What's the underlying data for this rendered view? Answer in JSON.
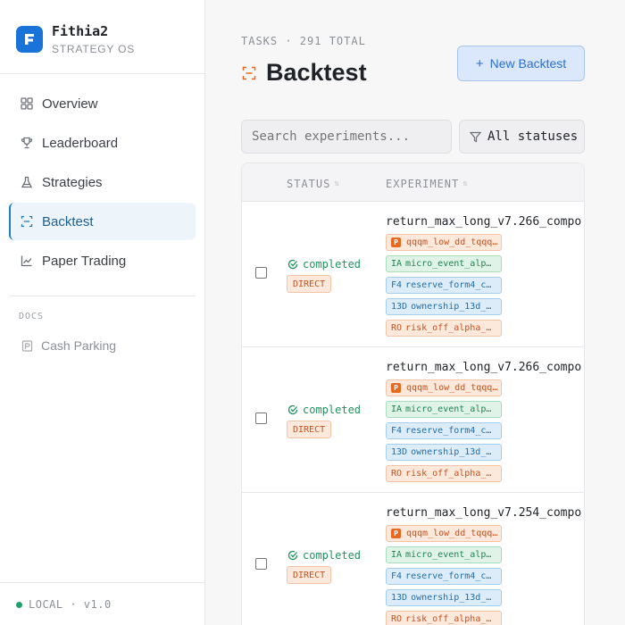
{
  "brand": {
    "name": "Fithia2",
    "subtitle": "STRATEGY OS",
    "logo_letter": "F"
  },
  "nav": [
    {
      "label": "Overview",
      "icon": "grid-icon"
    },
    {
      "label": "Leaderboard",
      "icon": "trophy-icon"
    },
    {
      "label": "Strategies",
      "icon": "flask-icon"
    },
    {
      "label": "Backtest",
      "icon": "scan-icon",
      "active": true
    },
    {
      "label": "Paper Trading",
      "icon": "chart-line-icon"
    }
  ],
  "docs": {
    "label": "DOCS",
    "items": [
      {
        "label": "Cash Parking",
        "icon": "document-icon"
      }
    ]
  },
  "footer": {
    "env": "LOCAL · v1.0",
    "status_color": "#22a06b"
  },
  "header": {
    "eyebrow": "TASKS · 291 TOTAL",
    "title": "Backtest",
    "new_button": "New Backtest"
  },
  "filters": {
    "search_placeholder": "Search experiments...",
    "status_filter": "All statuses"
  },
  "table": {
    "columns": [
      "STATUS",
      "EXPERIMENT"
    ],
    "rows": [
      {
        "status": "completed",
        "mode": "DIRECT",
        "name": "return_max_long_v7.266_compo",
        "tags": {
          "p": {
            "prefix": "P",
            "text": "qqqm_low_dd_tqqq…"
          },
          "ia": {
            "prefix": "IA",
            "text": "micro_event_alp…"
          },
          "f4": {
            "prefix": "F4",
            "text": "reserve_form4_c…"
          },
          "d13": {
            "prefix": "13D",
            "text": "ownership_13d_…"
          },
          "ro": {
            "prefix": "RO",
            "text": "risk_off_alpha_…"
          }
        }
      },
      {
        "status": "completed",
        "mode": "DIRECT",
        "name": "return_max_long_v7.266_compo",
        "tags": {
          "p": {
            "prefix": "P",
            "text": "qqqm_low_dd_tqqq…"
          },
          "ia": {
            "prefix": "IA",
            "text": "micro_event_alp…"
          },
          "f4": {
            "prefix": "F4",
            "text": "reserve_form4_c…"
          },
          "d13": {
            "prefix": "13D",
            "text": "ownership_13d_…"
          },
          "ro": {
            "prefix": "RO",
            "text": "risk_off_alpha_…"
          }
        }
      },
      {
        "status": "completed",
        "mode": "DIRECT",
        "name": "return_max_long_v7.254_compo",
        "tags": {
          "p": {
            "prefix": "P",
            "text": "qqqm_low_dd_tqqq…"
          },
          "ia": {
            "prefix": "IA",
            "text": "micro_event_alp…"
          },
          "f4": {
            "prefix": "F4",
            "text": "reserve_form4_c…"
          },
          "d13": {
            "prefix": "13D",
            "text": "ownership_13d_…"
          },
          "ro": {
            "prefix": "RO",
            "text": "risk_off_alpha_…"
          }
        }
      }
    ]
  },
  "colors": {
    "accent": "#1f7fc4",
    "success": "#22915f",
    "warning": "#c4521c"
  }
}
